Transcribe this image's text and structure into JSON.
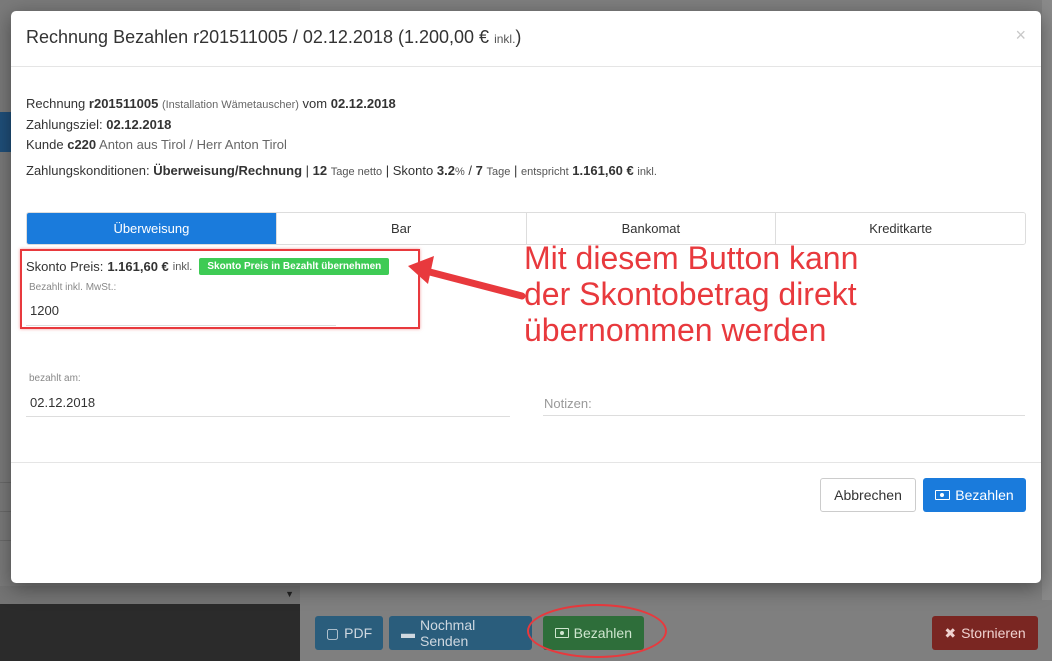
{
  "modal": {
    "title": "Rechnung Bezahlen r201511005 / 02.12.2018 (1.200,00 €",
    "title_small": "inkl.",
    "title_close": ")",
    "close_symbol": "×"
  },
  "invoice": {
    "rechnung_label": "Rechnung",
    "rechnung_nr": "r201511005",
    "rechnung_desc": "(Installation Wämetauscher)",
    "vom_label": "vom",
    "vom_date": "02.12.2018",
    "zahlungsziel_label": "Zahlungsziel:",
    "zahlungsziel_date": "02.12.2018",
    "kunde_label": "Kunde",
    "kunde_nr": "c220",
    "kunde_name": "Anton aus Tirol / Herr Anton Tirol"
  },
  "conditions": {
    "label": "Zahlungskonditionen:",
    "method": "Überweisung/Rechnung",
    "sep1": "|",
    "netto_days": "12",
    "netto_label": "Tage netto",
    "sep2": "|",
    "skonto_label": "Skonto",
    "skonto_pct": "3.2",
    "pct_sign": "%",
    "slash": "/",
    "skonto_days": "7",
    "days_label": "Tage",
    "sep3": "|",
    "entspricht_label": "entspricht",
    "entspricht_value": "1.161,60 €",
    "inkl": "inkl."
  },
  "tabs": [
    {
      "label": "Überweisung",
      "active": true
    },
    {
      "label": "Bar",
      "active": false
    },
    {
      "label": "Bankomat",
      "active": false
    },
    {
      "label": "Kreditkarte",
      "active": false
    }
  ],
  "skonto": {
    "label": "Skonto Preis:",
    "value": "1.161,60 €",
    "inkl": "inkl.",
    "button": "Skonto Preis in Bezahlt übernehmen"
  },
  "fields": {
    "bezahlt_label": "Bezahlt inkl. MwSt.:",
    "bezahlt_value": "1200",
    "bezahlt_am_label": "bezahlt am:",
    "bezahlt_am_value": "02.12.2018",
    "notizen_placeholder": "Notizen:"
  },
  "annotation": {
    "line1": "Mit diesem Button kann",
    "line2": "der Skontobetrag direkt",
    "line3": "übernommen werden"
  },
  "footer": {
    "cancel": "Abbrechen",
    "pay": "Bezahlen"
  },
  "background": {
    "pdf": "PDF",
    "resend": "Nochmal Senden",
    "pay": "Bezahlen",
    "storno": "Stornieren"
  },
  "colors": {
    "primary": "#1a7bdc",
    "success": "#3ecb55",
    "annotation": "#e8393d"
  }
}
